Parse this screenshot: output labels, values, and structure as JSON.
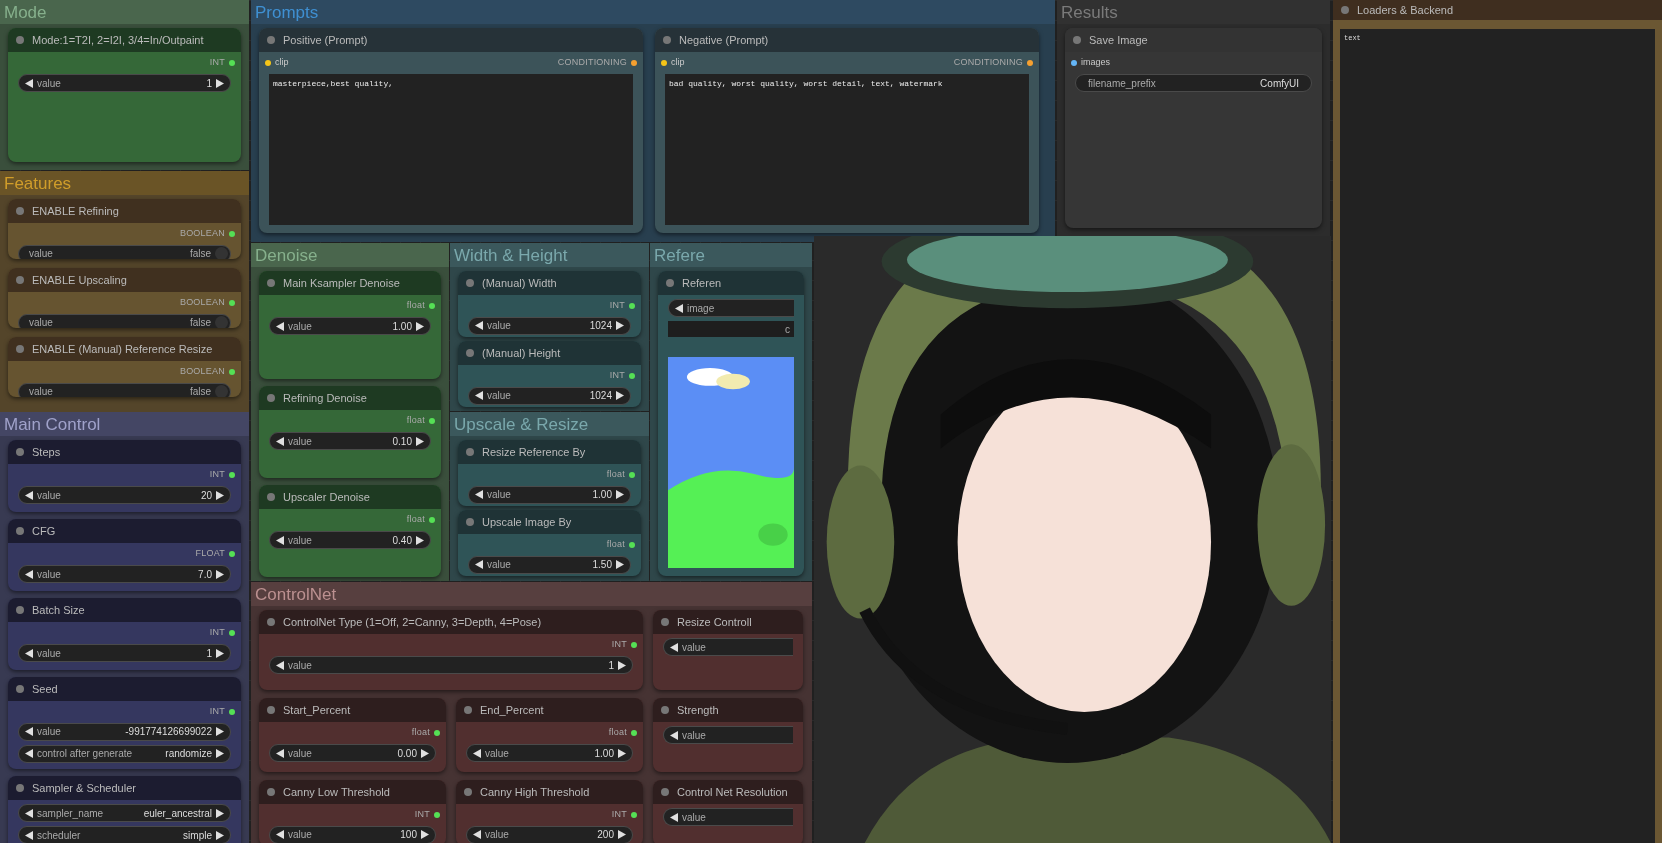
{
  "groups": [
    {
      "title": "Mode",
      "kind": "green",
      "nodes": [
        {
          "title": "Mode:1=T2I, 2=I2I, 3/4=In/Outpaint",
          "outputs": [
            {
              "label": "INT",
              "color": "#55e055"
            }
          ],
          "widgets": [
            {
              "kind": "number",
              "label": "value",
              "value": "1"
            }
          ]
        }
      ]
    },
    {
      "title": "Prompts",
      "kind": "blue",
      "nodes": [
        {
          "title": "Positive (Prompt)",
          "inputs": [
            {
              "label": "clip",
              "color": "#f5c518"
            }
          ],
          "outputs": [
            {
              "label": "CONDITIONING",
              "color": "#f5a030"
            }
          ],
          "text": "masterpiece,best quality,"
        },
        {
          "title": "Negative (Prompt)",
          "inputs": [
            {
              "label": "clip",
              "color": "#f5c518"
            }
          ],
          "outputs": [
            {
              "label": "CONDITIONING",
              "color": "#f5a030"
            }
          ],
          "text": "bad quality, worst quality, worst detail, text, watermark"
        }
      ]
    },
    {
      "title": "Results",
      "kind": "gray",
      "nodes": [
        {
          "title": "Save Image",
          "inputs": [
            {
              "label": "images",
              "color": "#64b5f6"
            }
          ],
          "widgets": [
            {
              "kind": "text",
              "label": "filename_prefix",
              "value": "ComfyUI"
            }
          ]
        }
      ]
    },
    {
      "title": "Features",
      "kind": "yellow",
      "nodes": [
        {
          "title": "ENABLE Refining",
          "outputs": [
            {
              "label": "BOOLEAN",
              "color": "#55e055"
            }
          ],
          "widgets": [
            {
              "kind": "toggle",
              "label": "value",
              "value": "false",
              "on": false
            }
          ]
        },
        {
          "title": "ENABLE Upscaling",
          "outputs": [
            {
              "label": "BOOLEAN",
              "color": "#55e055"
            }
          ],
          "widgets": [
            {
              "kind": "toggle",
              "label": "value",
              "value": "false",
              "on": false
            }
          ]
        },
        {
          "title": "ENABLE (Manual) Reference Resize",
          "outputs": [
            {
              "label": "BOOLEAN",
              "color": "#55e055"
            }
          ],
          "widgets": [
            {
              "kind": "toggle",
              "label": "value",
              "value": "false",
              "on": false
            }
          ]
        }
      ]
    },
    {
      "title": "Denoise",
      "kind": "green",
      "nodes": [
        {
          "title": "Main Ksampler Denoise",
          "outputs": [
            {
              "label": "float",
              "color": "#55e055"
            }
          ],
          "widgets": [
            {
              "kind": "number",
              "label": "value",
              "value": "1.00"
            }
          ]
        },
        {
          "title": "Refining Denoise",
          "outputs": [
            {
              "label": "float",
              "color": "#55e055"
            }
          ],
          "widgets": [
            {
              "kind": "number",
              "label": "value",
              "value": "0.10"
            }
          ]
        },
        {
          "title": "Upscaler Denoise",
          "outputs": [
            {
              "label": "float",
              "color": "#55e055"
            }
          ],
          "widgets": [
            {
              "kind": "number",
              "label": "value",
              "value": "0.40"
            }
          ]
        }
      ]
    },
    {
      "title": "Width & Height",
      "kind": "teal",
      "nodes": [
        {
          "title": "(Manual) Width",
          "outputs": [
            {
              "label": "INT",
              "color": "#55e055"
            }
          ],
          "widgets": [
            {
              "kind": "number",
              "label": "value",
              "value": "1024"
            }
          ]
        },
        {
          "title": "(Manual) Height",
          "outputs": [
            {
              "label": "INT",
              "color": "#55e055"
            }
          ],
          "widgets": [
            {
              "kind": "number",
              "label": "value",
              "value": "1024"
            }
          ]
        }
      ]
    },
    {
      "title": "Refere",
      "kind": "teal",
      "nodes": [
        {
          "title": "Referen",
          "kind": "preview",
          "widgets": [
            {
              "kind": "cut",
              "label": "image"
            },
            {
              "kind": "button",
              "label": "c"
            }
          ]
        }
      ]
    },
    {
      "title": "Main Control",
      "kind": "navy",
      "nodes": [
        {
          "title": "Steps",
          "outputs": [
            {
              "label": "INT",
              "color": "#55e055"
            }
          ],
          "widgets": [
            {
              "kind": "number",
              "label": "value",
              "value": "20"
            }
          ]
        },
        {
          "title": "CFG",
          "outputs": [
            {
              "label": "FLOAT",
              "color": "#55e055"
            }
          ],
          "widgets": [
            {
              "kind": "number",
              "label": "value",
              "value": "7.0"
            }
          ]
        },
        {
          "title": "Batch Size",
          "outputs": [
            {
              "label": "INT",
              "color": "#55e055"
            }
          ],
          "widgets": [
            {
              "kind": "number",
              "label": "value",
              "value": "1"
            }
          ]
        },
        {
          "title": "Seed",
          "outputs": [
            {
              "label": "INT",
              "color": "#55e055"
            }
          ],
          "widgets": [
            {
              "kind": "number",
              "label": "value",
              "value": "-991774126699022"
            },
            {
              "kind": "number",
              "label": "control after generate",
              "value": "randomize"
            }
          ]
        },
        {
          "title": "Sampler & Scheduler",
          "widgets": [
            {
              "kind": "number",
              "label": "sampler_name",
              "value": "euler_ancestral"
            },
            {
              "kind": "number",
              "label": "scheduler",
              "value": "simple"
            }
          ]
        }
      ]
    },
    {
      "title": "Upscale & Resize",
      "kind": "teal",
      "nodes": [
        {
          "title": "Resize Reference By",
          "outputs": [
            {
              "label": "float",
              "color": "#55e055"
            }
          ],
          "widgets": [
            {
              "kind": "number",
              "label": "value",
              "value": "1.00"
            }
          ]
        },
        {
          "title": "Upscale Image By",
          "outputs": [
            {
              "label": "float",
              "color": "#55e055"
            }
          ],
          "widgets": [
            {
              "kind": "number",
              "label": "value",
              "value": "1.50"
            }
          ]
        }
      ]
    },
    {
      "title": "ControlNet",
      "kind": "red",
      "nodes": [
        {
          "title": "ControlNet Type (1=Off, 2=Canny, 3=Depth, 4=Pose)",
          "outputs": [
            {
              "label": "INT",
              "color": "#55e055"
            }
          ],
          "widgets": [
            {
              "kind": "number",
              "label": "value",
              "value": "1"
            }
          ]
        },
        {
          "title": "Resize Controll",
          "widgets": [
            {
              "kind": "cut",
              "label": "value"
            }
          ]
        },
        {
          "title": "Start_Percent",
          "outputs": [
            {
              "label": "float",
              "color": "#55e055"
            }
          ],
          "widgets": [
            {
              "kind": "number",
              "label": "value",
              "value": "0.00"
            }
          ]
        },
        {
          "title": "End_Percent",
          "outputs": [
            {
              "label": "float",
              "color": "#55e055"
            }
          ],
          "widgets": [
            {
              "kind": "number",
              "label": "value",
              "value": "1.00"
            }
          ]
        },
        {
          "title": "Strength",
          "widgets": [
            {
              "kind": "cut",
              "label": "value"
            }
          ]
        },
        {
          "title": "Canny Low Threshold",
          "outputs": [
            {
              "label": "INT",
              "color": "#55e055"
            }
          ],
          "widgets": [
            {
              "kind": "number",
              "label": "value",
              "value": "100"
            }
          ]
        },
        {
          "title": "Canny High Threshold",
          "outputs": [
            {
              "label": "INT",
              "color": "#55e055"
            }
          ],
          "widgets": [
            {
              "kind": "number",
              "label": "value",
              "value": "200"
            }
          ]
        },
        {
          "title": "Control Net Resolution",
          "widgets": [
            {
              "kind": "cut",
              "label": "value"
            }
          ]
        }
      ]
    }
  ],
  "floating_node": {
    "title": "Loaders & Backend",
    "kind": "brown",
    "text": "text"
  }
}
